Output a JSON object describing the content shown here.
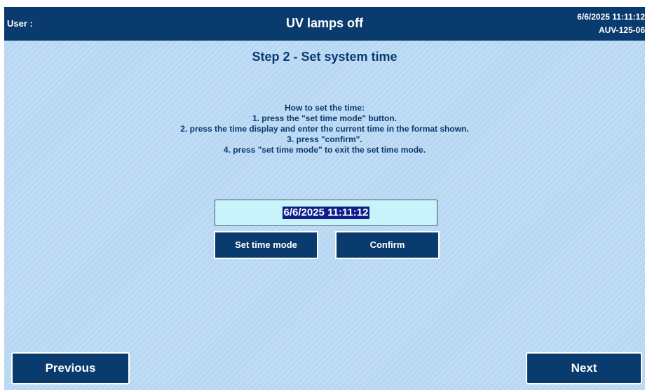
{
  "header": {
    "user_label": "User :",
    "status_title": "UV lamps off",
    "datetime": "6/6/2025 11:11:12",
    "device_id": "AUV-125-06"
  },
  "step": {
    "title": "Step 2 - Set system time"
  },
  "instructions": {
    "heading": "How to set the time:",
    "lines": [
      "1. press the \"set time mode\" button.",
      "2. press the time display and enter the current time in the format shown.",
      "3. press \"confirm\".",
      "4. press \"set time mode\" to exit the set time mode."
    ]
  },
  "time_display": {
    "value": "6/6/2025 11:11:12"
  },
  "buttons": {
    "set_time_mode": "Set time mode",
    "confirm": "Confirm",
    "previous": "Previous",
    "next": "Next"
  },
  "colors": {
    "header_bg": "#0a3b6e",
    "panel_bg": "#b7d7f3",
    "display_bg": "#c9f3fb",
    "selection_bg": "#0d1e8c"
  }
}
